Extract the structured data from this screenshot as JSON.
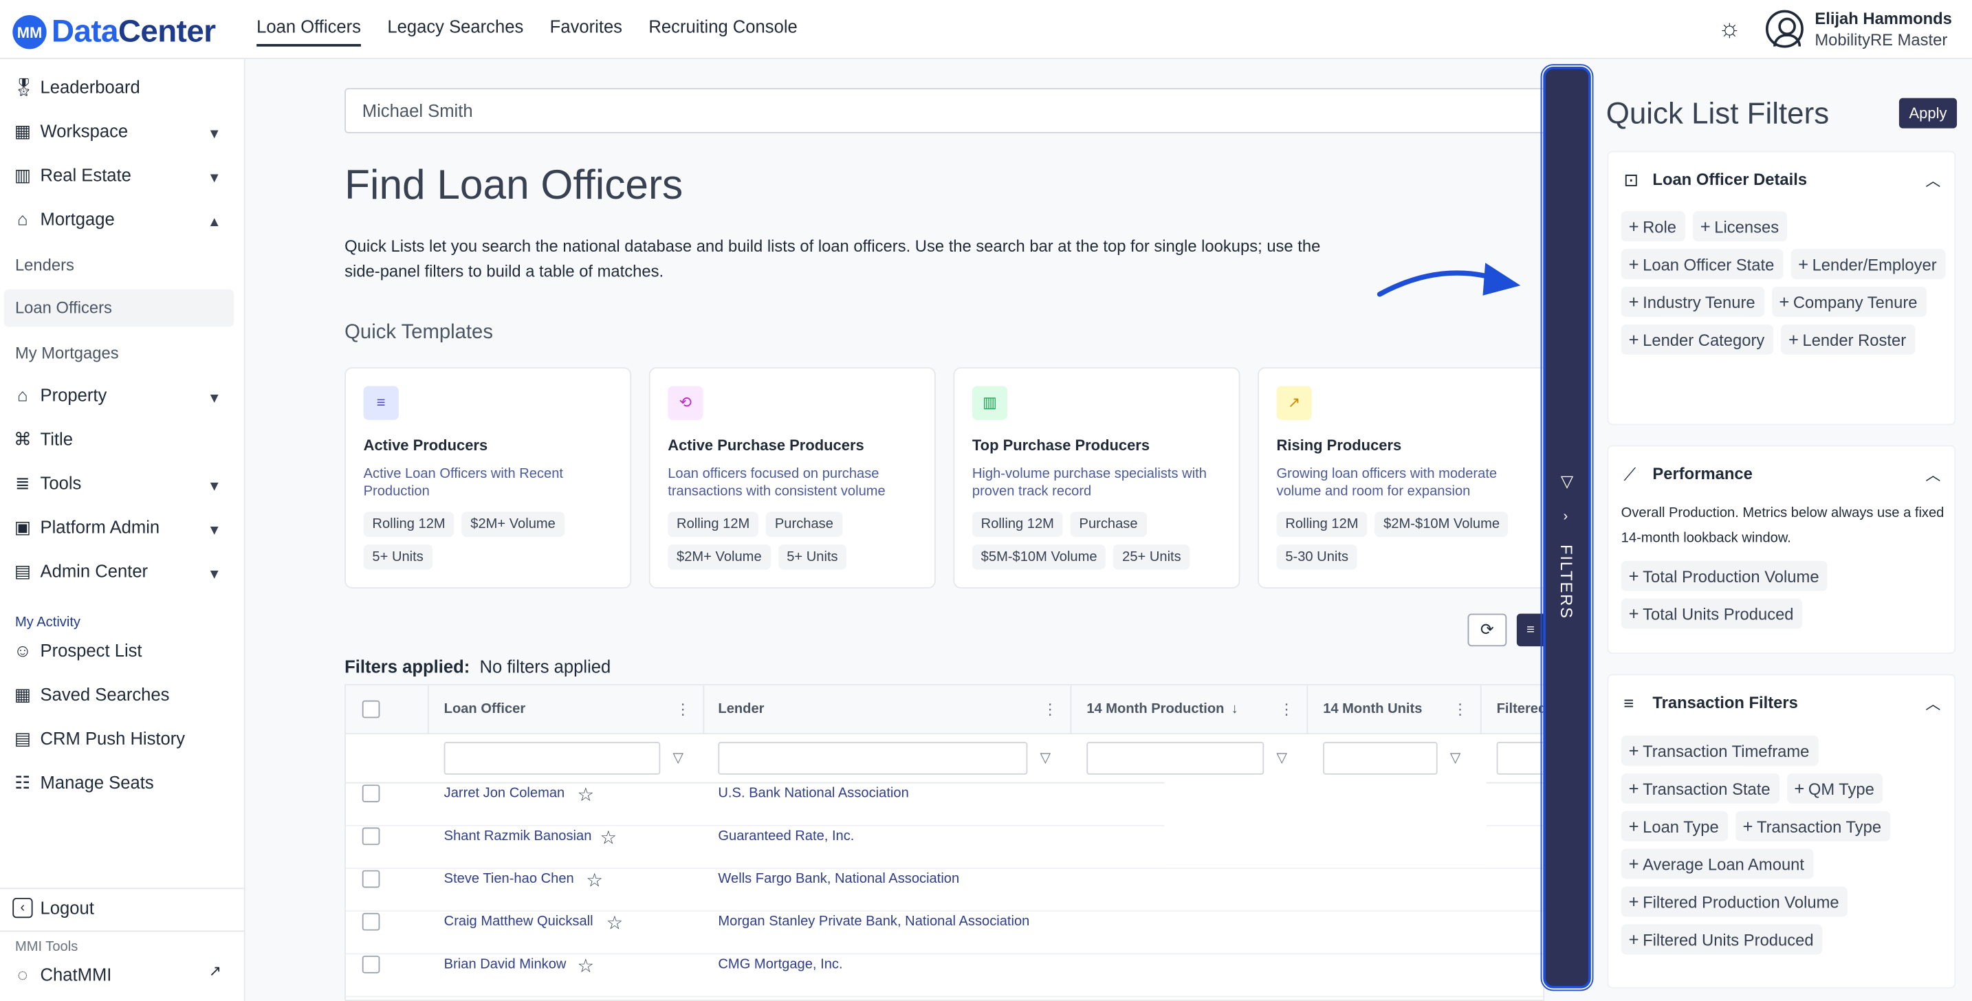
{
  "app": {
    "logo_mark": "MM",
    "logo_data": "Data",
    "logo_center": "Center"
  },
  "topnav": {
    "tabs": [
      "Loan Officers",
      "Legacy Searches",
      "Favorites",
      "Recruiting Console"
    ],
    "active_tab": "Loan Officers"
  },
  "user": {
    "name": "Elijah Hammonds",
    "org": "MobilityRE Master"
  },
  "sidebar": {
    "items": {
      "leaderboard": "Leaderboard",
      "workspace": "Workspace",
      "real_estate": "Real Estate",
      "mortgage": "Mortgage",
      "lenders": "Lenders",
      "loan_officers": "Loan Officers",
      "my_mortgages": "My Mortgages",
      "property": "Property",
      "title": "Title",
      "tools": "Tools",
      "platform_admin": "Platform Admin",
      "admin_center": "Admin Center"
    },
    "my_activity_label": "My Activity",
    "activity": {
      "prospect_list": "Prospect List",
      "saved_searches": "Saved Searches",
      "crm_push_history": "CRM Push History",
      "manage_seats": "Manage Seats"
    },
    "logout": "Logout",
    "mmi_tools_label": "MMI Tools",
    "chatmmi": "ChatMMI"
  },
  "search": {
    "value": "Michael Smith"
  },
  "main": {
    "title": "Find Loan Officers",
    "description": "Quick Lists let you search the national database and build lists of loan officers. Use the search bar at the top for single lookups; use the side-panel filters to build a table of matches.",
    "quick_templates_title": "Quick Templates"
  },
  "templates": [
    {
      "title": "Active Producers",
      "desc": "Active Loan Officers with Recent Production",
      "chips": [
        "Rolling 12M",
        "$2M+ Volume",
        "5+ Units"
      ],
      "icon": "list-icon",
      "color": "#e0e7ff"
    },
    {
      "title": "Active Purchase Producers",
      "desc": "Loan officers focused on purchase transactions with consistent volume",
      "chips": [
        "Rolling 12M",
        "Purchase",
        "$2M+ Volume",
        "5+ Units"
      ],
      "icon": "cycle-icon",
      "color": "#fae8ff"
    },
    {
      "title": "Top Purchase Producers",
      "desc": "High-volume purchase specialists with proven track record",
      "chips": [
        "Rolling 12M",
        "Purchase",
        "$5M-$10M Volume",
        "25+ Units"
      ],
      "icon": "chart-icon",
      "color": "#dcfce7"
    },
    {
      "title": "Rising Producers",
      "desc": "Growing loan officers with moderate volume and room for expansion",
      "chips": [
        "Rolling 12M",
        "$2M-$10M Volume",
        "5-30 Units"
      ],
      "icon": "trend-icon",
      "color": "#fef9c3"
    }
  ],
  "filters_applied": {
    "label": "Filters applied:",
    "value": "No filters applied"
  },
  "table": {
    "columns": [
      "Loan Officer",
      "Lender",
      "14 Month Production",
      "14 Month Units",
      "Filtered"
    ],
    "rows": [
      {
        "name": "Jarret Jon Coleman",
        "lender": "U.S. Bank National Association"
      },
      {
        "name": "Shant Razmik Banosian",
        "lender": "Guaranteed Rate, Inc."
      },
      {
        "name": "Steve Tien-hao Chen",
        "lender": "Wells Fargo Bank, National Association"
      },
      {
        "name": "Craig Matthew Quicksall",
        "lender": "Morgan Stanley Private Bank, National Association"
      },
      {
        "name": "Brian David Minkow",
        "lender": "CMG Mortgage, Inc."
      }
    ]
  },
  "filters_strip": {
    "label": "FILTERS"
  },
  "quick_list": {
    "title": "Quick List Filters",
    "apply": "Apply",
    "sections": [
      {
        "title": "Loan Officer Details",
        "icon": "chart-box-icon",
        "pills": [
          "Role",
          "Licenses",
          "Loan Officer State",
          "Lender/Employer",
          "Industry Tenure",
          "Company Tenure",
          "Lender Category",
          "Lender Roster"
        ]
      },
      {
        "title": "Performance",
        "icon": "line-chart-icon",
        "desc": "Overall Production. Metrics below always use a fixed 14-month lookback window.",
        "pills": [
          "Total Production Volume",
          "Total Units Produced"
        ]
      },
      {
        "title": "Transaction Filters",
        "icon": "filter-lines-icon",
        "pills": [
          "Transaction Timeframe",
          "Transaction State",
          "QM Type",
          "Loan Type",
          "Transaction Type",
          "Average Loan Amount",
          "Filtered Production Volume",
          "Filtered Units Produced"
        ]
      }
    ]
  },
  "colors": {
    "accent": "#2f3257",
    "brand": "#2563eb",
    "link": "#2f3e8c",
    "highlight": "#1d4ed8"
  }
}
